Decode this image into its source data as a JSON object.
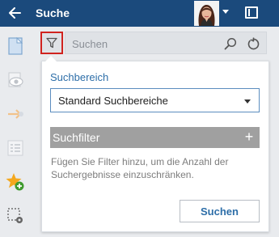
{
  "header": {
    "title": "Suche",
    "back_icon": "arrow-left-icon",
    "avatar_icon": "user-avatar",
    "window_icon": "window-panel-icon",
    "background": "#1b4a7c"
  },
  "rail": {
    "items": [
      {
        "name": "document-icon",
        "active": true
      },
      {
        "name": "eye-icon",
        "active": false
      },
      {
        "name": "arrow-right-icon",
        "active": false
      },
      {
        "name": "list-icon",
        "active": false
      },
      {
        "name": "favorite-add-icon",
        "active": false
      },
      {
        "name": "selection-settings-icon",
        "active": false
      }
    ]
  },
  "search": {
    "placeholder": "Suchen",
    "filter_icon": "funnel-icon",
    "search_icon": "magnifier-icon",
    "reset_icon": "reset-icon",
    "highlight_color": "#d0231f"
  },
  "panel": {
    "area_label": "Suchbereich",
    "area_value": "Standard Suchbereiche",
    "filter_label": "Suchfilter",
    "filter_add": "+",
    "hint": "Fügen Sie Filter hinzu, um die Anzahl der Suchergebnisse einzuschränken.",
    "search_button": "Suchen",
    "accent": "#2d6ea8"
  }
}
